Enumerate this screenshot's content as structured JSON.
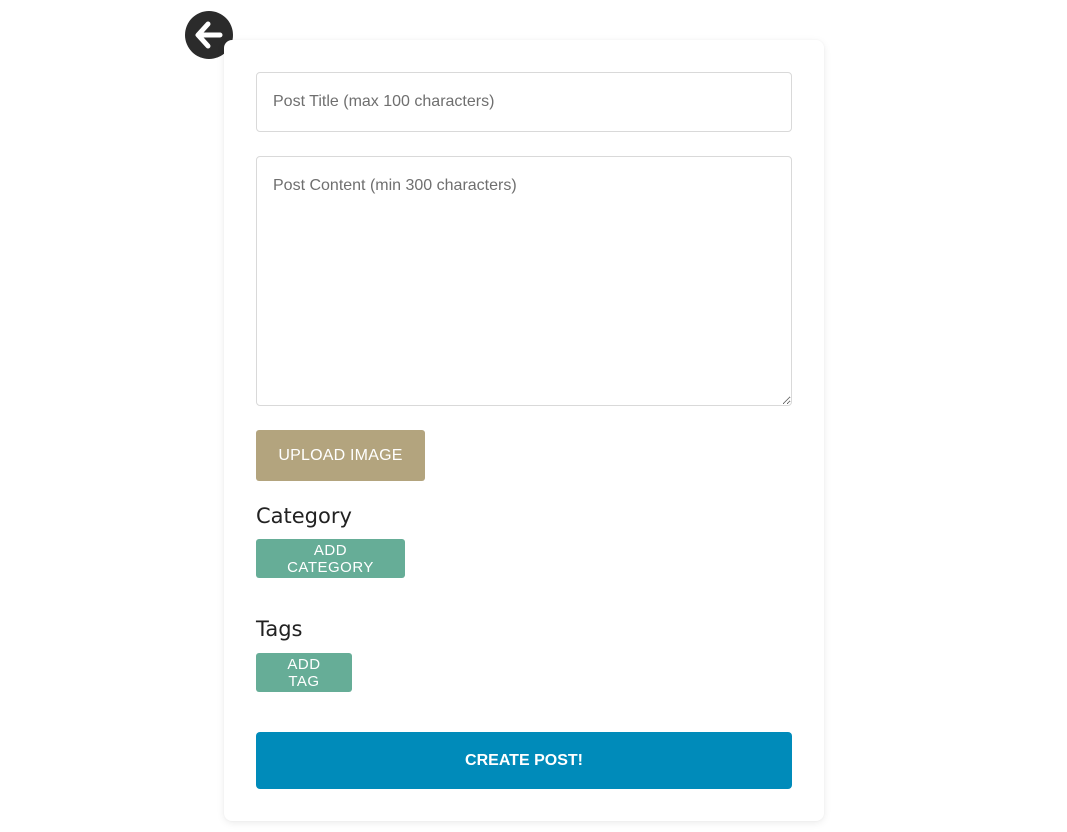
{
  "navigation": {
    "back_icon": "arrow-left-circle-icon"
  },
  "form": {
    "title_placeholder": "Post Title (max 100 characters)",
    "title_value": "",
    "content_placeholder": "Post Content (min 300 characters)",
    "content_value": "",
    "upload_label": "UPLOAD IMAGE",
    "category_heading": "Category",
    "add_category_label": "ADD CATEGORY",
    "tags_heading": "Tags",
    "add_tag_label": "ADD TAG",
    "submit_label": "CREATE POST!"
  },
  "colors": {
    "back_button": "#2b2b2b",
    "upload_button": "#b3a47e",
    "secondary_button": "#66ad97",
    "primary_button": "#008bba"
  }
}
